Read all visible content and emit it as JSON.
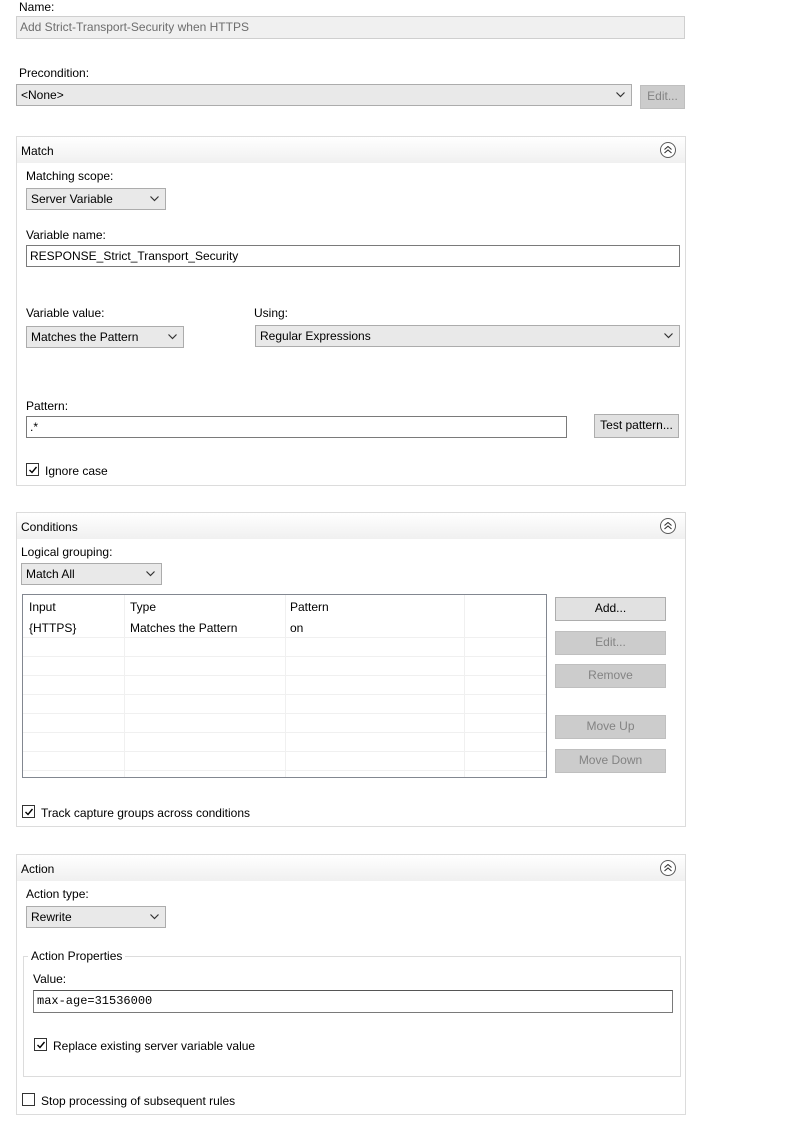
{
  "name": {
    "label": "Name:",
    "value": "Add Strict-Transport-Security when HTTPS"
  },
  "precondition": {
    "label": "Precondition:",
    "selected": "<None>",
    "edit_button": "Edit..."
  },
  "match": {
    "title": "Match",
    "matching_scope_label": "Matching scope:",
    "matching_scope_value": "Server Variable",
    "variable_name_label": "Variable name:",
    "variable_name_value": "RESPONSE_Strict_Transport_Security",
    "variable_value_label": "Variable value:",
    "variable_value_selected": "Matches the Pattern",
    "using_label": "Using:",
    "using_selected": "Regular Expressions",
    "pattern_label": "Pattern:",
    "pattern_value": ".*",
    "test_pattern_button": "Test pattern...",
    "ignore_case_label": "Ignore case",
    "ignore_case_checked": true
  },
  "conditions": {
    "title": "Conditions",
    "logical_grouping_label": "Logical grouping:",
    "logical_grouping_value": "Match All",
    "columns": [
      "Input",
      "Type",
      "Pattern"
    ],
    "rows": [
      {
        "input": "{HTTPS}",
        "type": "Matches the Pattern",
        "pattern": "on"
      }
    ],
    "buttons": {
      "add": "Add...",
      "edit": "Edit...",
      "remove": "Remove",
      "move_up": "Move Up",
      "move_down": "Move Down"
    },
    "track_capture_label": "Track capture groups across conditions",
    "track_capture_checked": true
  },
  "action": {
    "title": "Action",
    "action_type_label": "Action type:",
    "action_type_value": "Rewrite",
    "properties_title": "Action Properties",
    "value_label": "Value:",
    "value": "max-age=31536000",
    "replace_label": "Replace existing server variable value",
    "replace_checked": true,
    "stop_processing_label": "Stop processing of subsequent rules",
    "stop_processing_checked": false
  },
  "colors": {
    "button_face": "#e1e1e1",
    "disabled_button": "#cccccc",
    "panel_border": "#dcdcdc",
    "readonly_field": "#f0f0f0"
  }
}
